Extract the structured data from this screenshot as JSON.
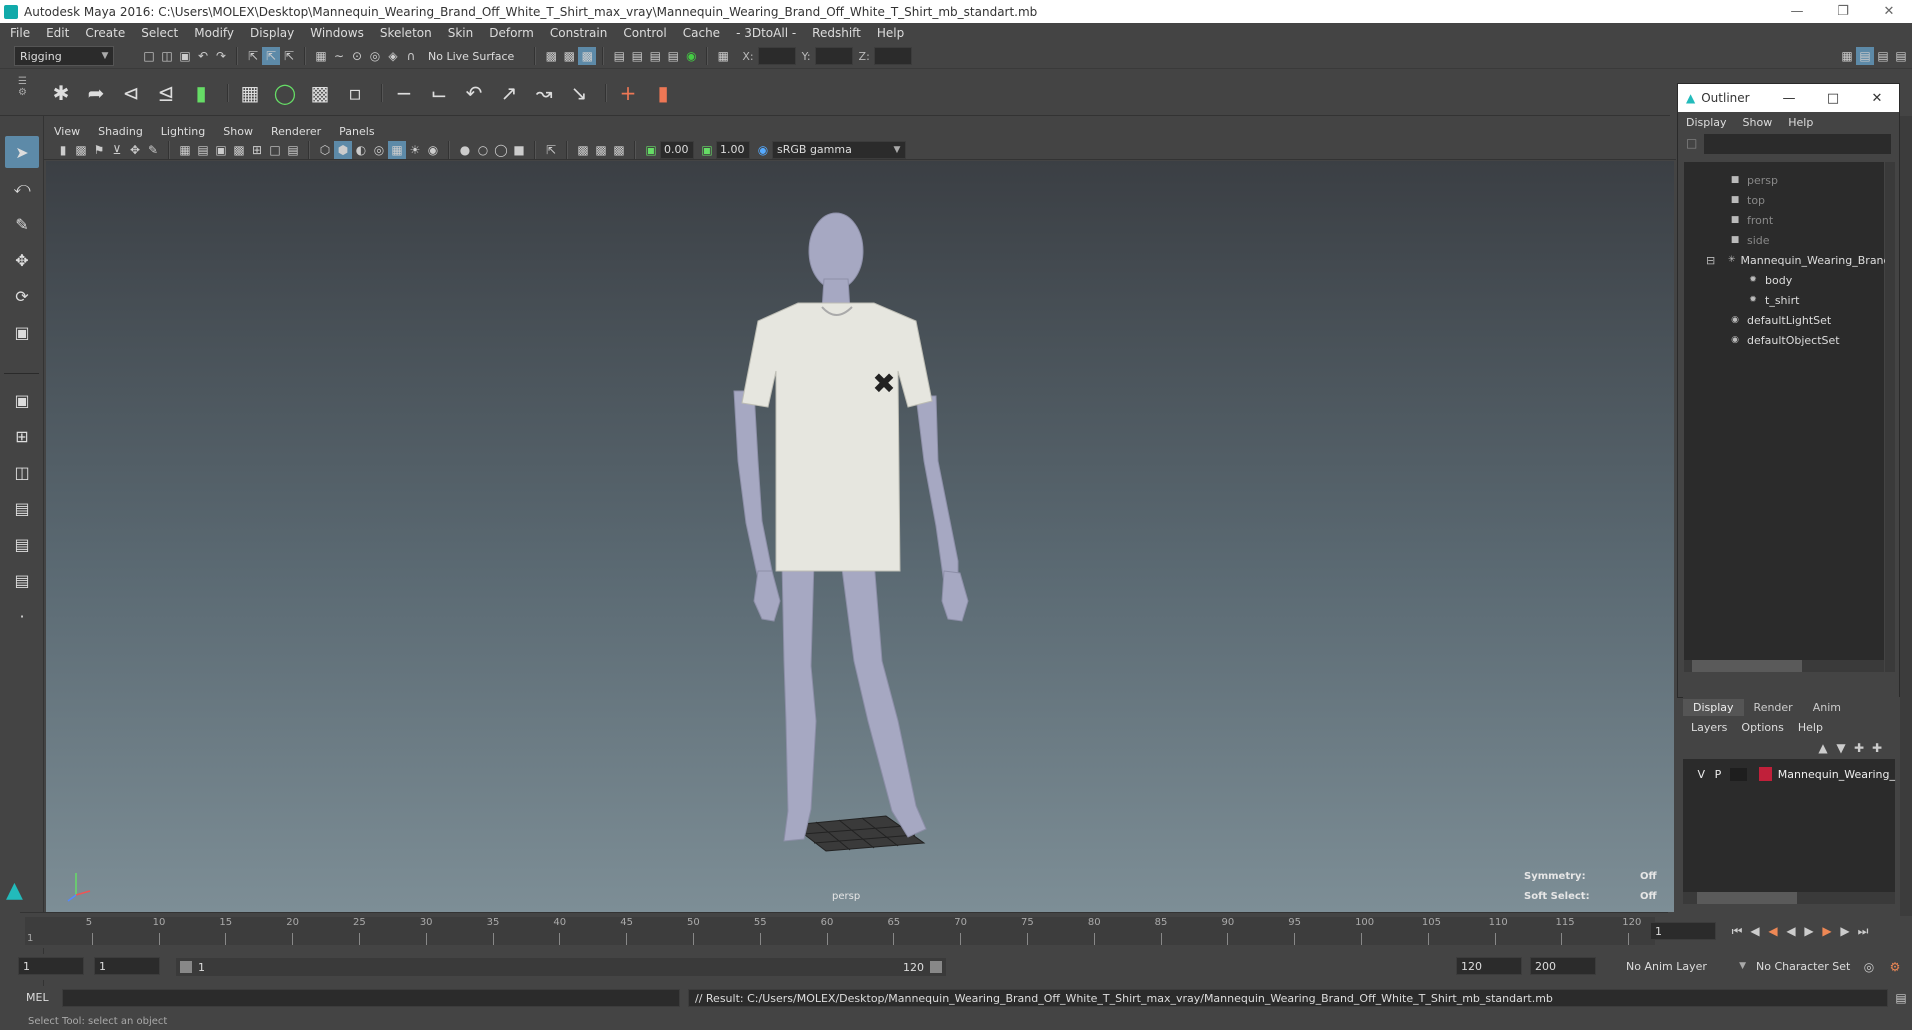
{
  "window": {
    "title": "Autodesk Maya 2016: C:\\Users\\MOLEX\\Desktop\\Mannequin_Wearing_Brand_Off_White_T_Shirt_max_vray\\Mannequin_Wearing_Brand_Off_White_T_Shirt_mb_standart.mb"
  },
  "menubar": [
    "File",
    "Edit",
    "Create",
    "Select",
    "Modify",
    "Display",
    "Windows",
    "Skeleton",
    "Skin",
    "Deform",
    "Constrain",
    "Control",
    "Cache",
    "- 3DtoAll -",
    "Redshift",
    "Help"
  ],
  "statusline": {
    "mode": "Rigging",
    "live_surface": "No Live Surface",
    "x_label": "X:",
    "y_label": "Y:",
    "z_label": "Z:"
  },
  "viewport": {
    "menu": [
      "View",
      "Shading",
      "Lighting",
      "Show",
      "Renderer",
      "Panels"
    ],
    "exposure": "0.00",
    "gamma": "1.00",
    "color_space": "sRGB gamma",
    "camera_label": "persp",
    "hud": {
      "symmetry_label": "Symmetry:",
      "symmetry_value": "Off",
      "soft_select_label": "Soft Select:",
      "soft_select_value": "Off"
    }
  },
  "outliner": {
    "title": "Outliner",
    "menu": [
      "Display",
      "Show",
      "Help"
    ],
    "items": [
      {
        "label": "persp",
        "icon": "camera-icon",
        "dim": true,
        "indent": 0
      },
      {
        "label": "top",
        "icon": "camera-icon",
        "dim": true,
        "indent": 0
      },
      {
        "label": "front",
        "icon": "camera-icon",
        "dim": true,
        "indent": 0
      },
      {
        "label": "side",
        "icon": "camera-icon",
        "dim": true,
        "indent": 0
      },
      {
        "label": "Mannequin_Wearing_Brand",
        "icon": "group-icon",
        "dim": false,
        "indent": 0
      },
      {
        "label": "body",
        "icon": "mesh-icon",
        "dim": false,
        "indent": 1
      },
      {
        "label": "t_shirt",
        "icon": "mesh-icon",
        "dim": false,
        "indent": 1
      },
      {
        "label": "defaultLightSet",
        "icon": "set-icon",
        "dim": false,
        "indent": 0
      },
      {
        "label": "defaultObjectSet",
        "icon": "set-icon",
        "dim": false,
        "indent": 0
      }
    ]
  },
  "layers": {
    "tabs": [
      "Display",
      "Render",
      "Anim"
    ],
    "menu": [
      "Layers",
      "Options",
      "Help"
    ],
    "rows": [
      {
        "v": "V",
        "p": "P",
        "color": "#c0203a",
        "name": "Mannequin_Wearing_"
      }
    ]
  },
  "timeline": {
    "ticks": [
      5,
      10,
      15,
      20,
      25,
      30,
      35,
      40,
      45,
      50,
      55,
      60,
      65,
      70,
      75,
      80,
      85,
      90,
      95,
      100,
      105,
      110,
      115,
      120
    ],
    "start_label": "1",
    "current_frame": "1"
  },
  "range": {
    "start": "1",
    "playback_start": "1",
    "slider_start": "1",
    "slider_end": "120",
    "playback_end": "120",
    "end": "200",
    "anim_layer": "No Anim Layer",
    "char_set": "No Character Set"
  },
  "command": {
    "lang": "MEL",
    "result": "// Result: C:/Users/MOLEX/Desktop/Mannequin_Wearing_Brand_Off_White_T_Shirt_max_vray/Mannequin_Wearing_Brand_Off_White_T_Shirt_mb_standart.mb"
  },
  "helpline": "Select Tool: select an object",
  "colors": {
    "accent": "#5d8aa8",
    "layer_red": "#c0203a",
    "viewport_top": "#3b3f44",
    "viewport_bottom": "#7d8e96"
  }
}
